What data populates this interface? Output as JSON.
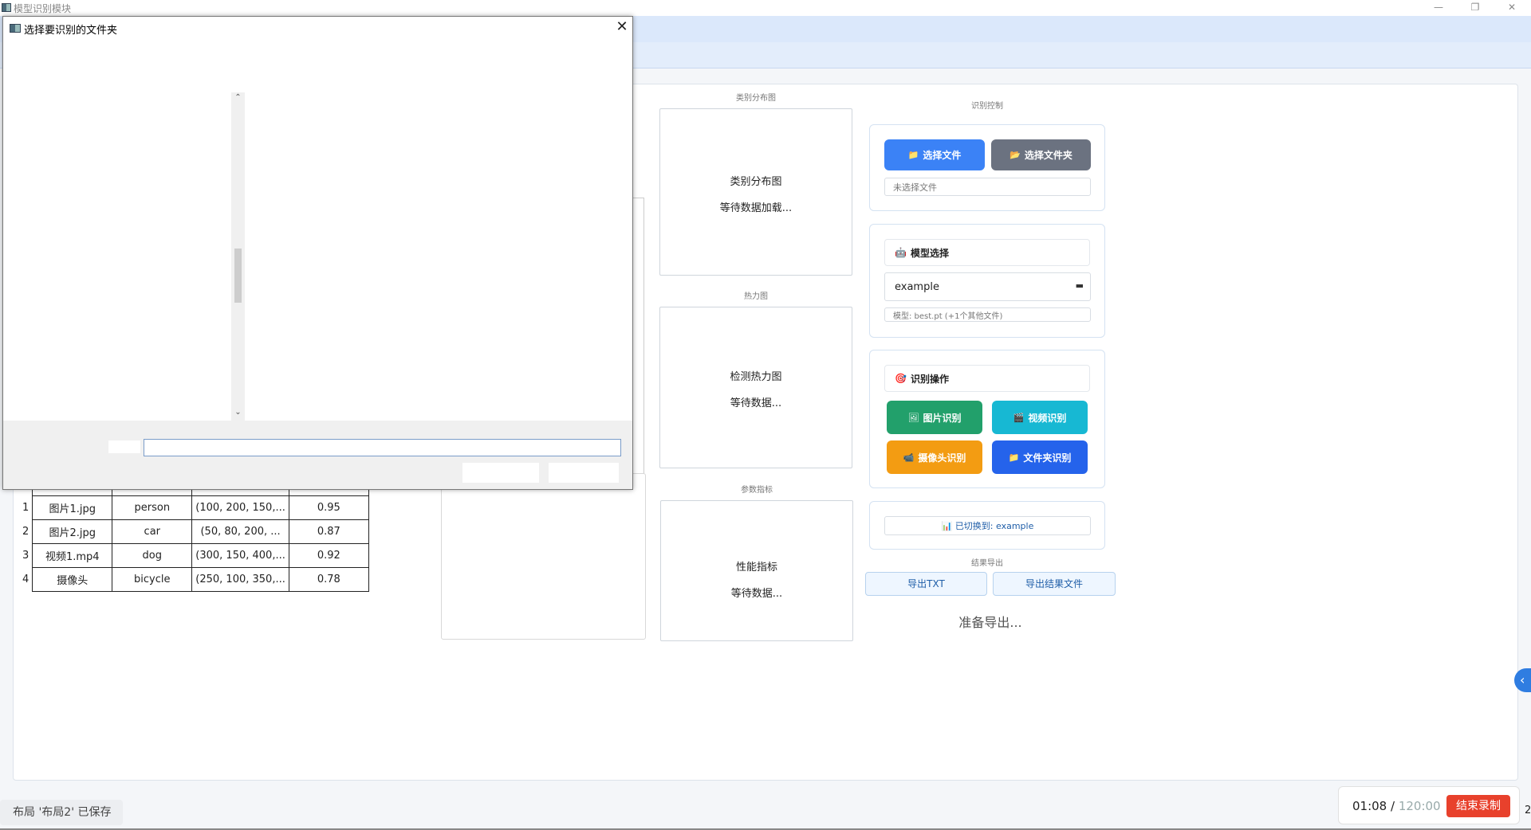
{
  "window": {
    "title": "模型识别模块",
    "minimize": "—",
    "restore": "❐",
    "close": "✕"
  },
  "results_table": {
    "rows": [
      {
        "n": "1",
        "source": "图片1.jpg",
        "label": "person",
        "coords": "(100, 200, 150,...",
        "conf": "0.95"
      },
      {
        "n": "2",
        "source": "图片2.jpg",
        "label": "car",
        "coords": "(50, 80, 200, ...",
        "conf": "0.87"
      },
      {
        "n": "3",
        "source": "视频1.mp4",
        "label": "dog",
        "coords": "(300, 150, 400,...",
        "conf": "0.92"
      },
      {
        "n": "4",
        "source": "摄像头",
        "label": "bicycle",
        "coords": "(250, 100, 350,...",
        "conf": "0.78"
      }
    ]
  },
  "charts": {
    "class_dist": {
      "title": "类别分布图",
      "line1": "类别分布图",
      "line2": "等待数据加载..."
    },
    "heatmap": {
      "title": "热力图",
      "line1": "检测热力图",
      "line2": "等待数据..."
    },
    "metrics": {
      "title": "参数指标",
      "line1": "性能指标",
      "line2": "等待数据..."
    }
  },
  "control": {
    "title": "识别控制",
    "select_file": "选择文件",
    "select_folder": "选择文件夹",
    "file_placeholder": "未选择文件",
    "model_section": "模型选择",
    "model_value": "example",
    "model_info": "模型: best.pt (+1个其他文件)",
    "ops_section": "识别操作",
    "img_recognize": "图片识别",
    "video_recognize": "视频识别",
    "camera_recognize": "摄像头识别",
    "folder_recognize": "文件夹识别",
    "status": "已切换到: example",
    "export_title": "结果导出",
    "export_txt": "导出TXT",
    "export_file": "导出结果文件",
    "export_status": "准备导出..."
  },
  "dialog": {
    "title": "选择要识别的文件夹",
    "folder_input": ""
  },
  "footer": {
    "saved_note": "布局 '布局2' 已保存",
    "rec_elapsed": "01:08",
    "rec_sep": " / ",
    "rec_total": "120:00",
    "rec_stop": "结束录制",
    "edge_char": "2"
  },
  "colors": {
    "btn_select_file": "#3b82f6",
    "btn_select_folder": "#6b7280",
    "btn_img": "#22a06b",
    "btn_video": "#17b8d3",
    "btn_camera": "#f39c12",
    "btn_folder": "#2563eb"
  }
}
